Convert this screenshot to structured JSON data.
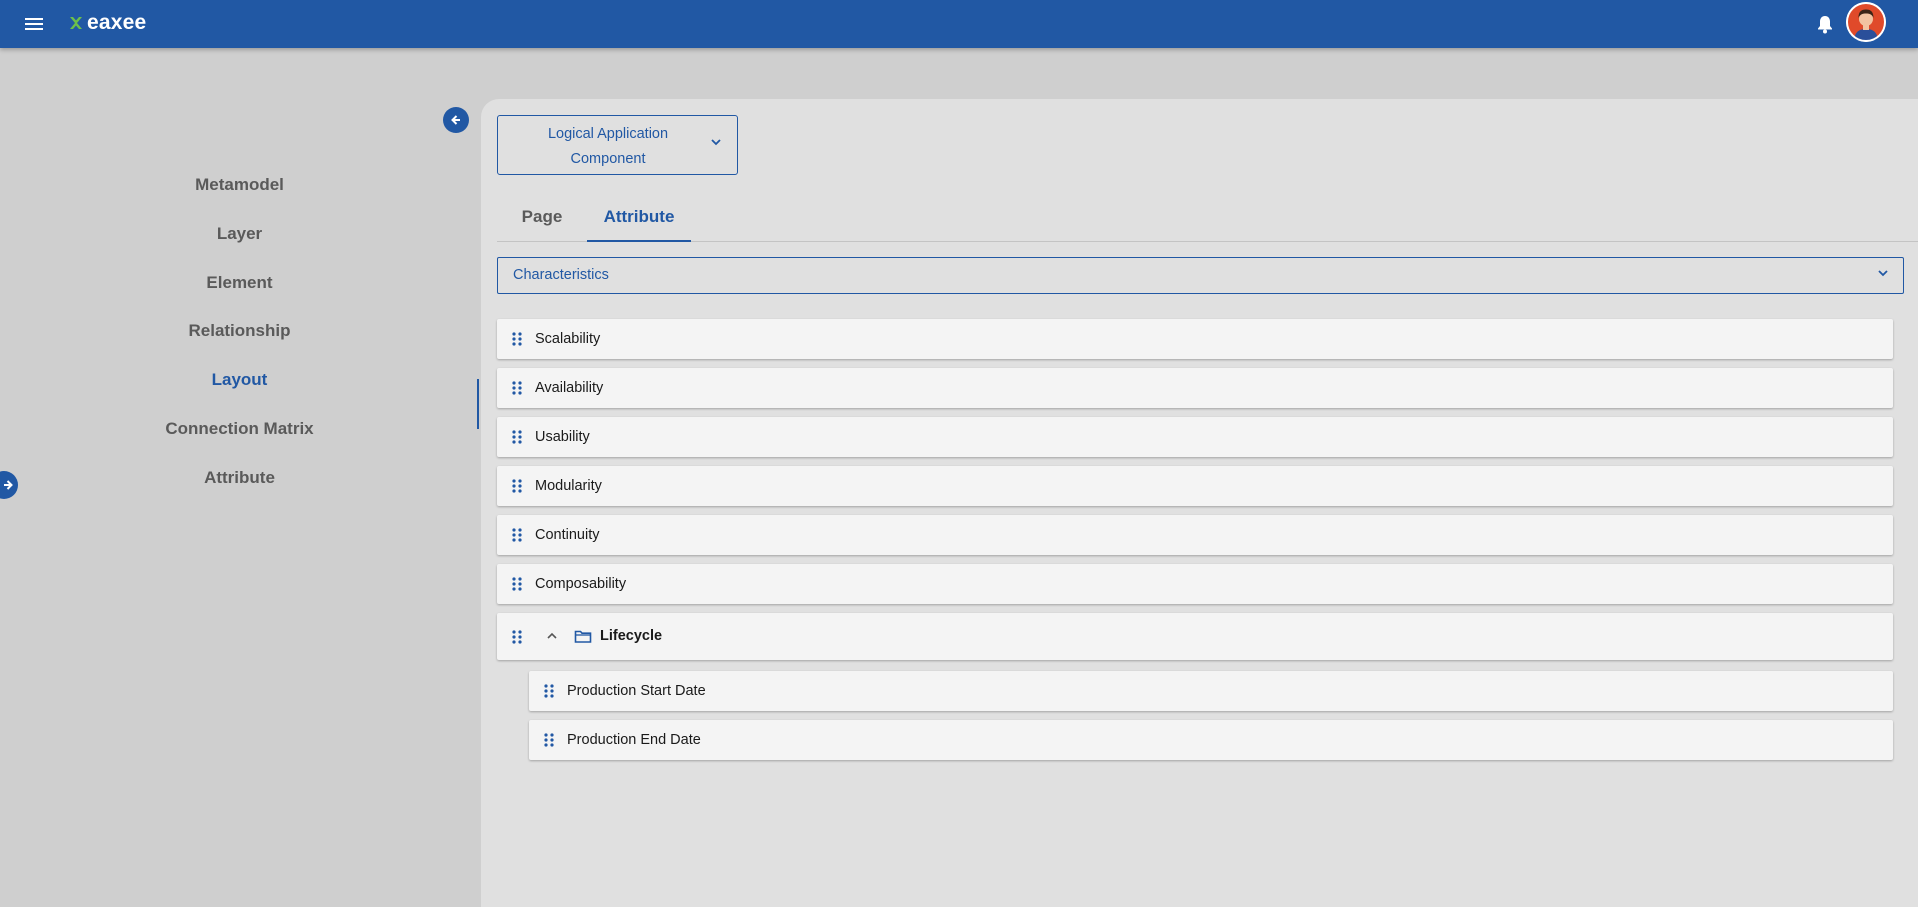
{
  "app": {
    "name": "eaxee"
  },
  "colors": {
    "primary": "#2158a4",
    "logo_accent": "#6cc04a"
  },
  "header": {
    "menu_icon": "hamburger-menu-icon",
    "notification_icon": "bell-icon",
    "avatar_icon": "user-avatar"
  },
  "sidebar": {
    "collapse_icon": "arrow-left-icon",
    "expand_icon": "arrow-right-icon",
    "items": [
      {
        "label": "Metamodel",
        "active": false
      },
      {
        "label": "Layer",
        "active": false
      },
      {
        "label": "Element",
        "active": false
      },
      {
        "label": "Relationship",
        "active": false
      },
      {
        "label": "Layout",
        "active": true
      },
      {
        "label": "Connection Matrix",
        "active": false
      },
      {
        "label": "Attribute",
        "active": false
      }
    ]
  },
  "main": {
    "element_type": {
      "value": "Logical Application Component",
      "icon": "chevron-down-icon"
    },
    "tabs": [
      {
        "label": "Page",
        "active": false
      },
      {
        "label": "Attribute",
        "active": true
      }
    ],
    "group_select": {
      "value": "Characteristics",
      "icon": "chevron-down-icon"
    },
    "attributes": [
      {
        "label": "Scalability"
      },
      {
        "label": "Availability"
      },
      {
        "label": "Usability"
      },
      {
        "label": "Modularity"
      },
      {
        "label": "Continuity"
      },
      {
        "label": "Composability"
      }
    ],
    "group": {
      "label": "Lifecycle",
      "expanded": true,
      "toggle_icon": "chevron-up-icon",
      "folder_icon": "folder-icon",
      "children": [
        {
          "label": "Production Start Date"
        },
        {
          "label": "Production End Date"
        }
      ]
    }
  }
}
